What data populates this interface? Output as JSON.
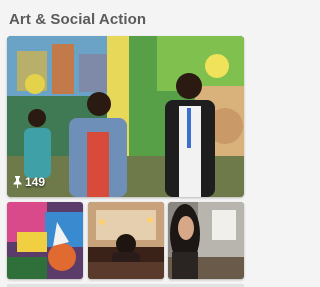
{
  "board": {
    "title": "Art & Social Action",
    "pin_count": "149",
    "pin_icon": "pushpin-icon",
    "cover_image": "mural-group-photo",
    "thumbnails": [
      {
        "image": "graffiti-art-thumbnail"
      },
      {
        "image": "candlelit-room-thumbnail"
      },
      {
        "image": "woman-portrait-thumbnail"
      }
    ]
  },
  "colors": {
    "title": "#5b5b5b",
    "background": "#f4f4f4"
  }
}
